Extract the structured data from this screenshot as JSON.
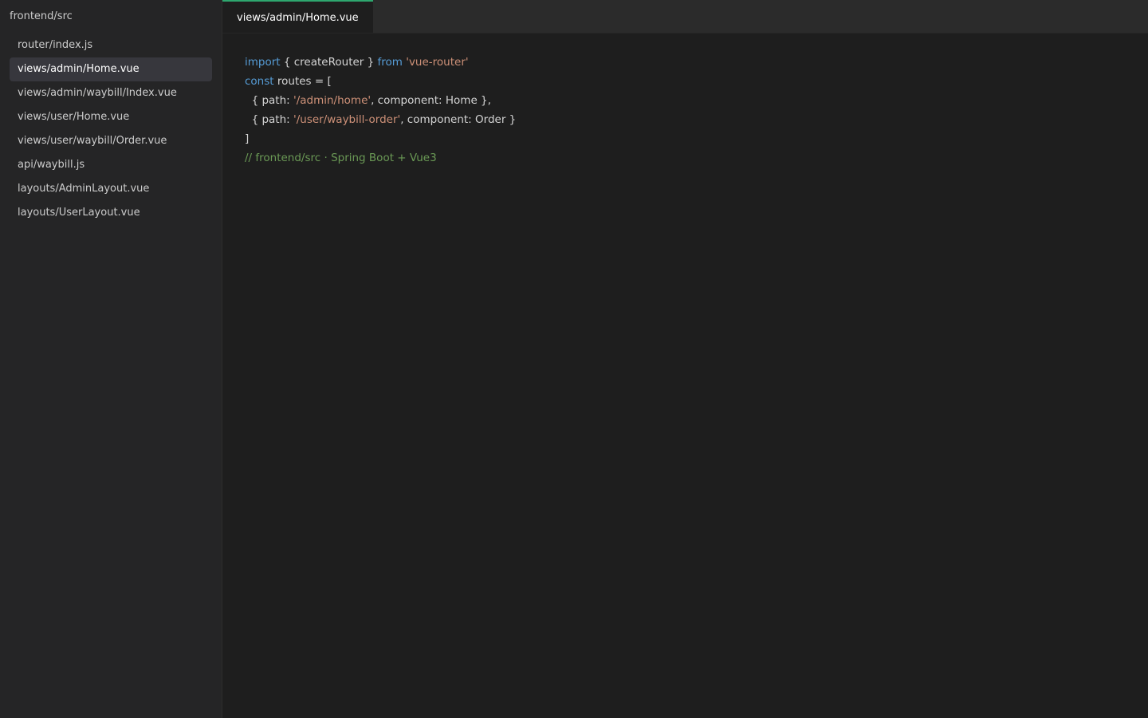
{
  "sidebar": {
    "title": "frontend/src",
    "items": [
      {
        "label": "router/index.js",
        "active": false
      },
      {
        "label": "views/admin/Home.vue",
        "active": true
      },
      {
        "label": "views/admin/waybill/Index.vue",
        "active": false
      },
      {
        "label": "views/user/Home.vue",
        "active": false
      },
      {
        "label": "views/user/waybill/Order.vue",
        "active": false
      },
      {
        "label": "api/waybill.js",
        "active": false
      },
      {
        "label": "layouts/AdminLayout.vue",
        "active": false
      },
      {
        "label": "layouts/UserLayout.vue",
        "active": false
      }
    ]
  },
  "tabs": [
    {
      "label": "views/admin/Home.vue",
      "active": true
    }
  ],
  "code": {
    "line1": {
      "kw1": "import",
      "p1": " { createRouter } ",
      "kw2": "from",
      "p2": " ",
      "s1": "'vue-router'"
    },
    "line2": {
      "kw1": "const",
      "p1": " routes = ["
    },
    "line3": {
      "p1": "  { path: ",
      "s1": "'/admin/home'",
      "p2": ", component: Home },"
    },
    "line4": {
      "p1": "  { path: ",
      "s1": "'/user/waybill-order'",
      "p2": ", component: Order }"
    },
    "line5": {
      "p1": "]"
    },
    "line6": {
      "c1": "// frontend/src · Spring Boot + Vue3"
    }
  },
  "colors": {
    "accent": "#2ea76f",
    "keyword": "#569cd6",
    "string": "#ce9178",
    "comment": "#6a9955"
  }
}
